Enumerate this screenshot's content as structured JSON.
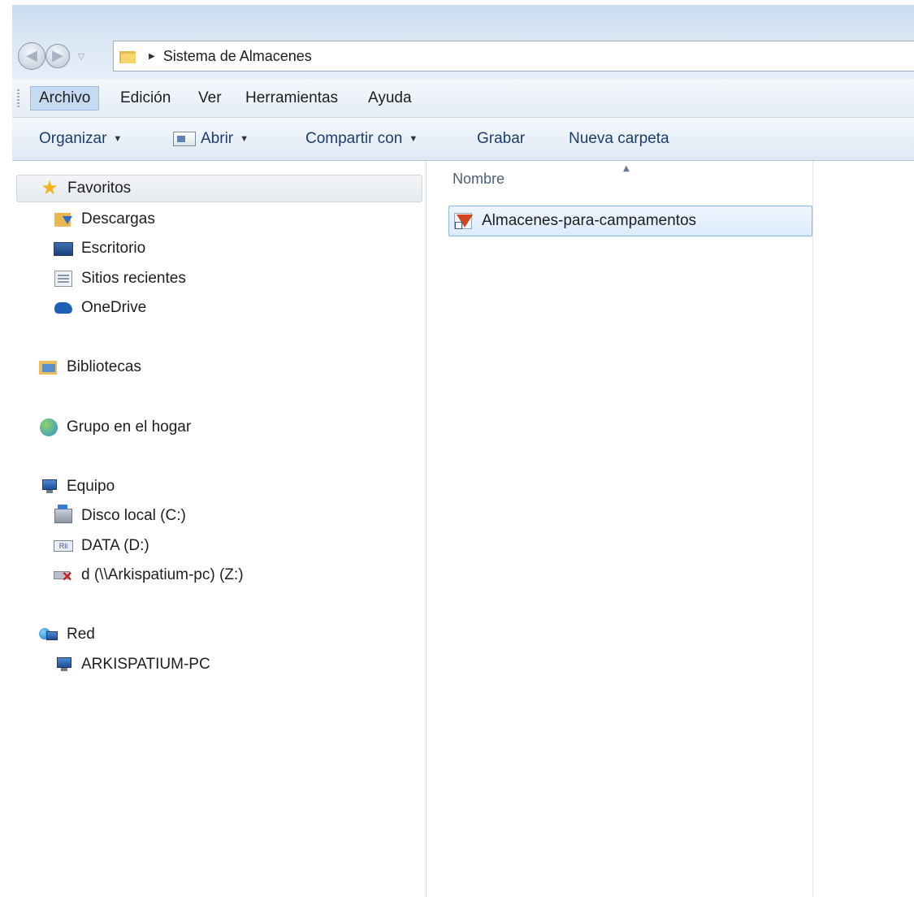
{
  "address": {
    "breadcrumb": "Sistema de Almacenes"
  },
  "menu": {
    "items": [
      "Archivo",
      "Edición",
      "Ver",
      "Herramientas",
      "Ayuda"
    ]
  },
  "toolbar": {
    "organizar": "Organizar",
    "abrir": "Abrir",
    "compartir": "Compartir con",
    "grabar": "Grabar",
    "nueva_carpeta": "Nueva carpeta"
  },
  "nav": {
    "favoritos": "Favoritos",
    "descargas": "Descargas",
    "escritorio": "Escritorio",
    "sitios_recientes": "Sitios recientes",
    "onedrive": "OneDrive",
    "bibliotecas": "Bibliotecas",
    "grupo_hogar": "Grupo en el hogar",
    "equipo": "Equipo",
    "disco_local": "Disco local (C:)",
    "data_d": "DATA (D:)",
    "data_icon_text": "Rli",
    "net_drive": "d (\\\\Arkispatium-pc) (Z:)",
    "red": "Red",
    "arkispatium_pc": "ARKISPATIUM-PC"
  },
  "files": {
    "column_name": "Nombre",
    "items": [
      {
        "name": "Almacenes-para-campamentos"
      }
    ]
  },
  "icons": {
    "back": "back-arrow-icon",
    "forward": "forward-arrow-icon",
    "favorites": "star-icon",
    "downloads": "downloads-folder-icon",
    "desktop": "desktop-icon",
    "recent": "recent-places-icon",
    "onedrive": "cloud-icon",
    "libraries": "libraries-icon",
    "homegroup": "homegroup-icon",
    "computer": "computer-icon",
    "network": "network-icon",
    "shortcut": "shortcut-icon"
  },
  "colors": {
    "accent": "#c6dbf2",
    "selection_border": "#8fb6e0",
    "toolbar_text": "#1e3d6b",
    "star": "#f2b21a",
    "error_x": "#d21a1a"
  }
}
